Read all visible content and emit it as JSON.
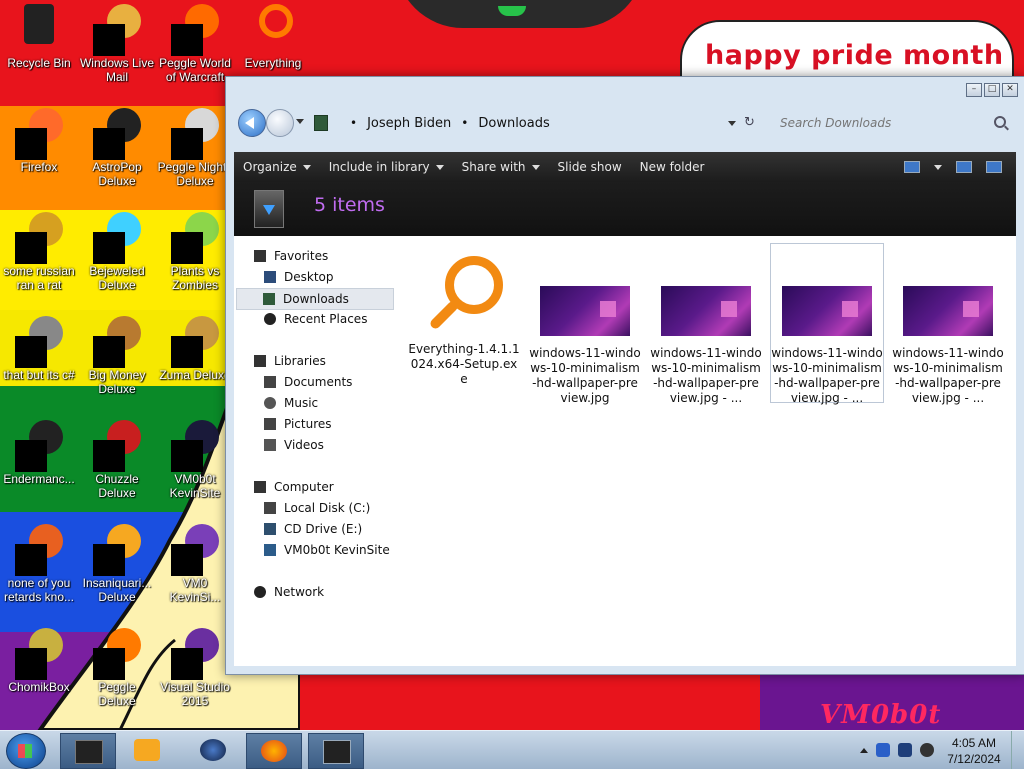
{
  "wallpaper": {
    "banner_text": "happy pride month",
    "corner_text": "VM0b0t"
  },
  "desktop_icons": [
    {
      "label": "Recycle Bin",
      "icon": "recycle-bin-icon"
    },
    {
      "label": "Windows Live Mail",
      "icon": "mail-icon"
    },
    {
      "label": "Peggle World of Warcraft",
      "icon": "peggle-icon"
    },
    {
      "label": "Everything",
      "icon": "magnifier-icon"
    },
    {
      "label": "Firefox",
      "icon": "firefox-icon"
    },
    {
      "label": "AstroPop Deluxe",
      "icon": "game-icon"
    },
    {
      "label": "Peggle Nights Deluxe",
      "icon": "peggle-icon"
    },
    {
      "label": "some russian ran a rat",
      "icon": "app-icon"
    },
    {
      "label": "Bejeweled Deluxe",
      "icon": "gem-icon"
    },
    {
      "label": "Plants vs Zombies",
      "icon": "plant-icon"
    },
    {
      "label": "that but its c#",
      "icon": "app-icon"
    },
    {
      "label": "Big Money Deluxe",
      "icon": "money-icon"
    },
    {
      "label": "Zuma Deluxe",
      "icon": "game-icon"
    },
    {
      "label": "Endermanc...",
      "icon": "app-icon"
    },
    {
      "label": "Chuzzle Deluxe",
      "icon": "game-icon"
    },
    {
      "label": "VM0b0t KevinSite",
      "icon": "app-icon"
    },
    {
      "label": "none of you retards kno...",
      "icon": "app-icon"
    },
    {
      "label": "Insaniquari... Deluxe",
      "icon": "fish-icon"
    },
    {
      "label": "VM0 KevinSi...",
      "icon": "app-icon"
    },
    {
      "label": "ChomikBox",
      "icon": "app-icon"
    },
    {
      "label": "Peggle Deluxe",
      "icon": "peggle-icon"
    },
    {
      "label": "Visual Studio 2015",
      "icon": "visual-studio-icon"
    }
  ],
  "explorer": {
    "breadcrumb": [
      "Joseph Biden",
      "Downloads"
    ],
    "search_placeholder": "Search Downloads",
    "toolbar": {
      "organize": "Organize",
      "include_in_library": "Include in library",
      "share_with": "Share with",
      "slide_show": "Slide show",
      "new_folder": "New folder"
    },
    "items_count": "5 items",
    "nav": {
      "favorites": "Favorites",
      "desktop": "Desktop",
      "downloads": "Downloads",
      "recent_places": "Recent Places",
      "libraries": "Libraries",
      "documents": "Documents",
      "music": "Music",
      "pictures": "Pictures",
      "videos": "Videos",
      "computer": "Computer",
      "local_disk": "Local Disk (C:)",
      "cd_drive": "CD Drive (E:)",
      "vm_share": "VM0b0t KevinSite",
      "network": "Network"
    },
    "files": [
      {
        "name": "Everything-1.4.1.1024.x64-Setup.exe",
        "type": "exe"
      },
      {
        "name": "windows-11-windows-10-minimalism-hd-wallpaper-preview.jpg",
        "type": "jpg"
      },
      {
        "name": "windows-11-windows-10-minimalism-hd-wallpaper-preview.jpg - ...",
        "type": "jpg"
      },
      {
        "name": "windows-11-windows-10-minimalism-hd-wallpaper-preview.jpg - ...",
        "type": "jpg"
      },
      {
        "name": "windows-11-windows-10-minimalism-hd-wallpaper-preview.jpg - ...",
        "type": "jpg"
      }
    ]
  },
  "taskbar": {
    "time": "4:05 AM",
    "date": "7/12/2024",
    "items": [
      "explorer-icon",
      "media-player-icon",
      "globe-icon",
      "firefox-icon",
      "window-icon"
    ]
  }
}
